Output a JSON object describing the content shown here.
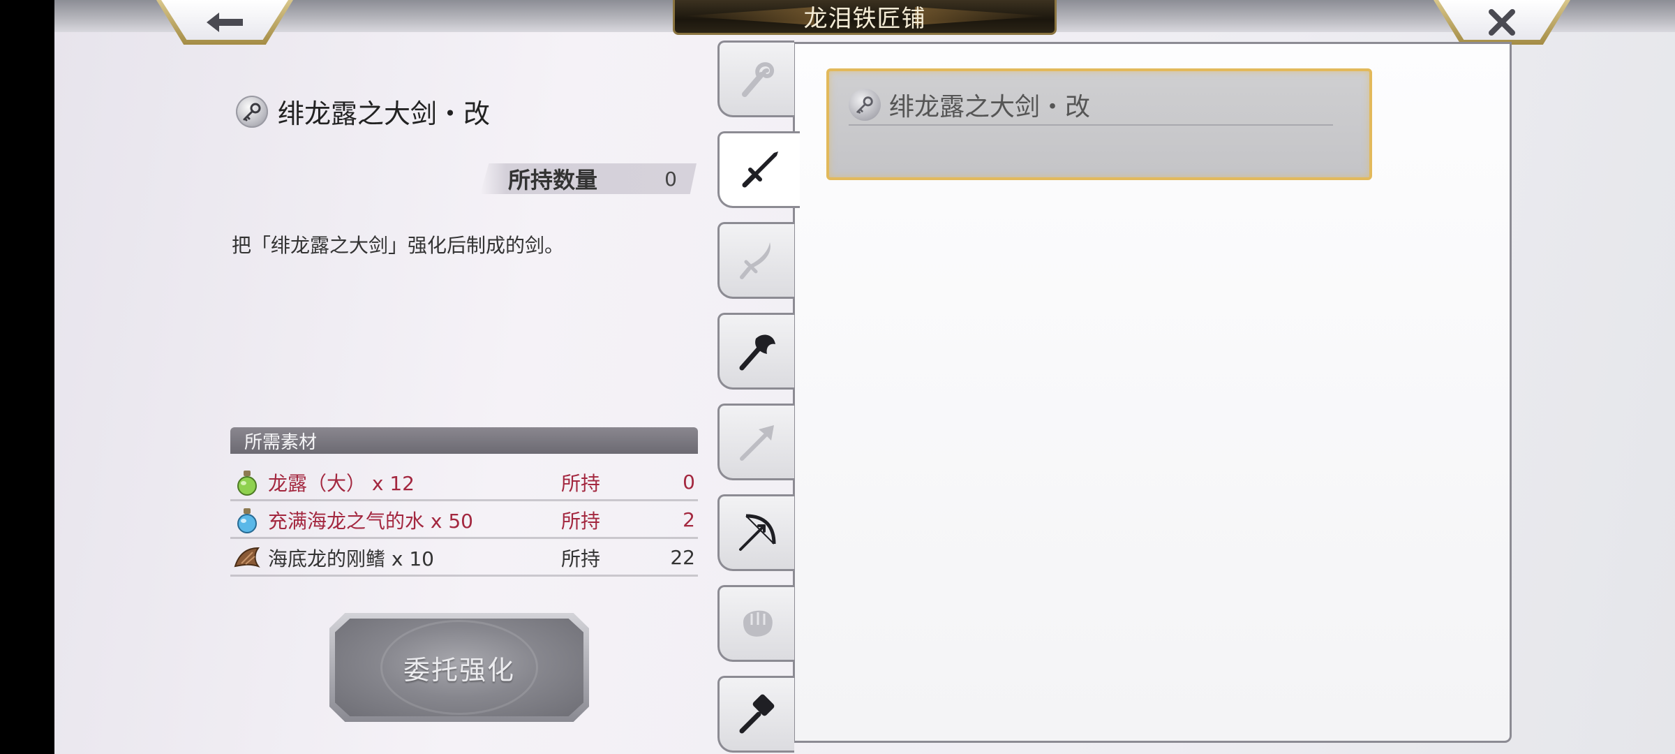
{
  "header": {
    "title": "龙泪铁匠铺",
    "back_icon": "arrow-left-icon",
    "close_icon": "close-icon"
  },
  "detail": {
    "weapon_name": "绯龙露之大剑・改",
    "owned_label": "所持数量",
    "owned_count": "0",
    "description": "把「绯龙露之大剑」强化后制成的剑。"
  },
  "materials": {
    "header": "所需素材",
    "rows": [
      {
        "icon": "green-potion-icon",
        "name": "龙露（大） x 12",
        "owned_label": "所持",
        "owned": "0",
        "status": "insufficient"
      },
      {
        "icon": "blue-potion-icon",
        "name": "充满海龙之气的水 x 50",
        "owned_label": "所持",
        "owned": "2",
        "status": "insufficient"
      },
      {
        "icon": "fin-icon",
        "name": "海底龙的刚鳍 x 10",
        "owned_label": "所持",
        "owned": "22",
        "status": "sufficient"
      }
    ]
  },
  "action": {
    "confirm_label": "委托强化"
  },
  "tabs": [
    {
      "icon": "staff-icon",
      "active": false
    },
    {
      "icon": "sword-icon",
      "active": true
    },
    {
      "icon": "curved-blade-icon",
      "active": false
    },
    {
      "icon": "axe-icon",
      "active": false
    },
    {
      "icon": "spear-icon",
      "active": false
    },
    {
      "icon": "bow-icon",
      "active": false
    },
    {
      "icon": "fist-icon",
      "active": false
    },
    {
      "icon": "hammer-icon",
      "active": false
    }
  ],
  "list": {
    "items": [
      {
        "name": "绯龙露之大剑・改",
        "selected": true
      }
    ]
  },
  "colors": {
    "accent_gold": "#e2b95b",
    "insufficient_red": "#a3273f",
    "title_bar": "#1b160d"
  }
}
